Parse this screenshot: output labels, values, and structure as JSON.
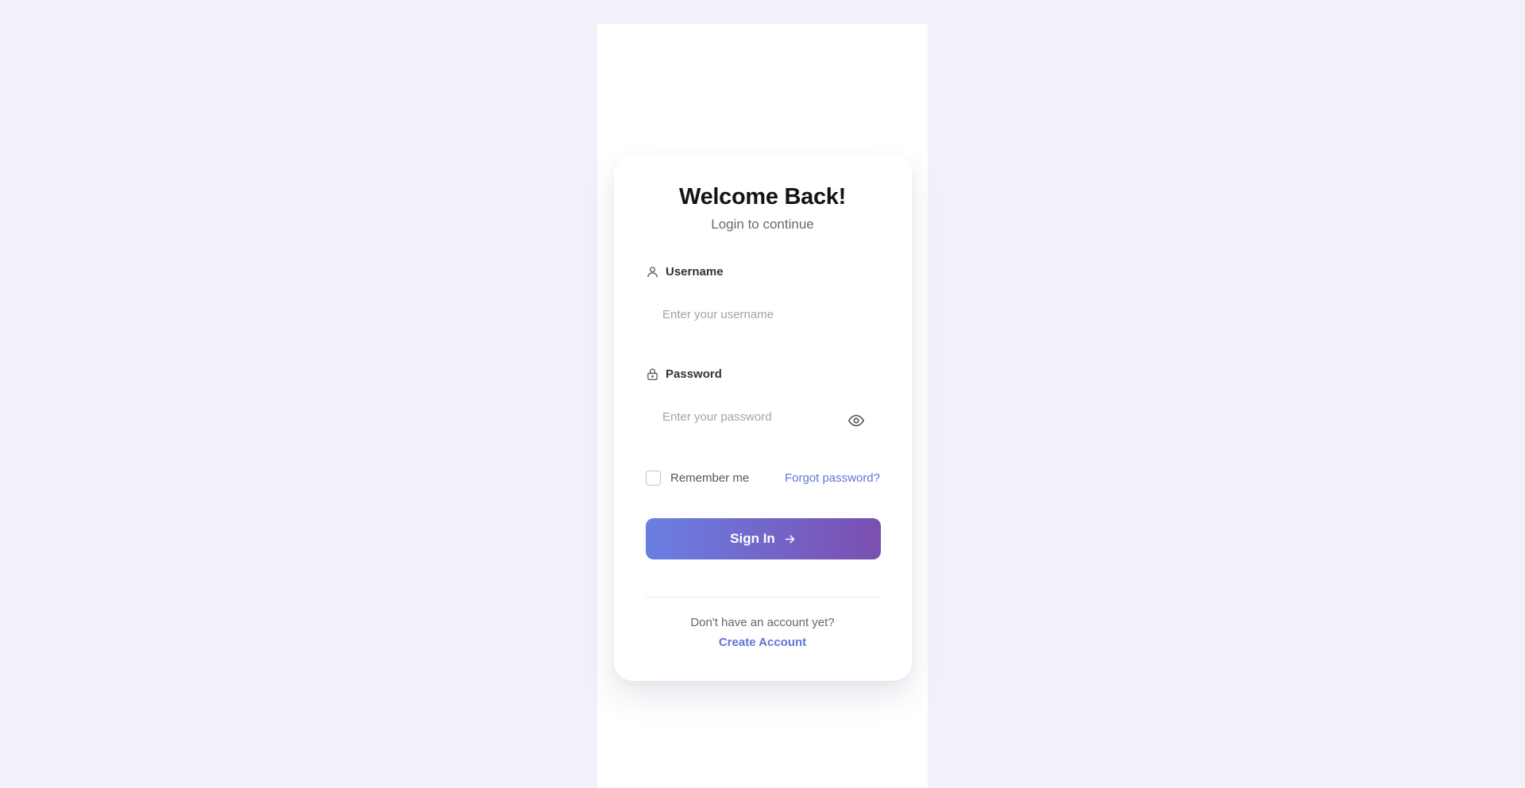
{
  "login": {
    "title": "Welcome Back!",
    "subtitle": "Login to continue",
    "username": {
      "label": "Username",
      "placeholder": "Enter your username",
      "value": ""
    },
    "password": {
      "label": "Password",
      "placeholder": "Enter your password",
      "value": ""
    },
    "remember_label": "Remember me",
    "forgot_label": "Forgot password?",
    "signin_label": "Sign In",
    "no_account_text": "Don't have an account yet?",
    "create_account_label": "Create Account"
  },
  "icons": {
    "username": "user-icon",
    "password": "lock-icon",
    "toggle_visibility": "eye-icon",
    "signin": "arrow-right-icon"
  },
  "colors": {
    "background": "#f0f1f9",
    "accent": "#6175d9",
    "button_gradient_start": "#6a7fe3",
    "button_gradient_end": "#7a4fb0"
  }
}
